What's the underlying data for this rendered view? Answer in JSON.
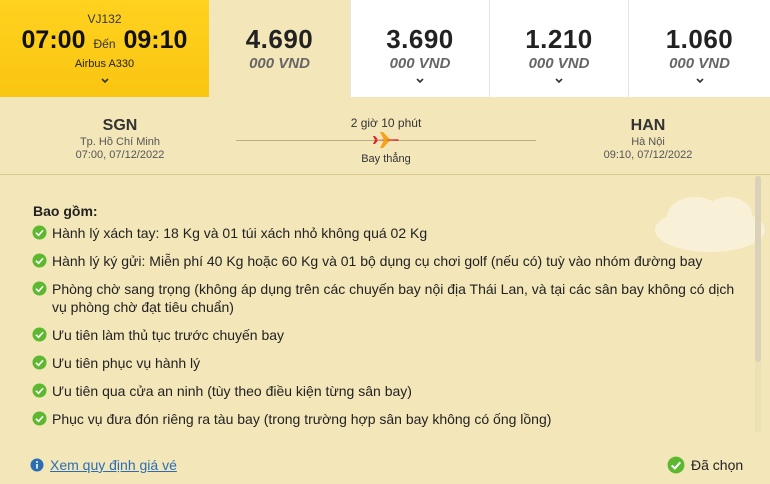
{
  "flight": {
    "code": "VJ132",
    "depart_time": "07:00",
    "connector": "Đến",
    "arrive_time": "09:10",
    "aircraft": "Airbus A330"
  },
  "fares": [
    {
      "amount": "4.690",
      "currency": "000 VND"
    },
    {
      "amount": "3.690",
      "currency": "000 VND"
    },
    {
      "amount": "1.210",
      "currency": "000 VND"
    },
    {
      "amount": "1.060",
      "currency": "000 VND"
    }
  ],
  "route": {
    "from": {
      "code": "SGN",
      "city": "Tp. Hồ Chí Minh",
      "datetime": "07:00, 07/12/2022"
    },
    "to": {
      "code": "HAN",
      "city": "Hà Nội",
      "datetime": "09:10, 07/12/2022"
    },
    "duration": "2 giờ 10 phút",
    "type": "Bay thẳng"
  },
  "details": {
    "title": "Bao gồm:",
    "benefits": [
      "Hành lý xách tay: 18 Kg và 01 túi xách nhỏ không quá 02 Kg",
      "Hành lý ký gửi: Miễn phí 40 Kg hoặc 60 Kg và 01 bộ dụng cụ chơi golf (nếu có) tuỳ vào nhóm đường bay",
      "Phòng chờ sang trọng (không áp dụng trên các chuyến bay nội địa Thái Lan, và tại các sân bay không có dịch vụ phòng chờ đạt tiêu chuẩn)",
      "Ưu tiên làm thủ tục trước chuyến bay",
      "Ưu tiên phục vụ hành lý",
      "Ưu tiên qua cửa an ninh (tùy theo điều kiện từng sân bay)",
      "Phục vụ đưa đón riêng ra tàu bay (trong trường hợp sân bay không có ống lồng)"
    ]
  },
  "footer": {
    "rules_link": "Xem quy định giá vé",
    "selected_label": "Đã chọn"
  },
  "icons": {
    "check": "check-circle-icon",
    "info": "info-icon",
    "plane": "plane-icon",
    "chevron": "chevron-down-icon"
  },
  "colors": {
    "brand_yellow": "#f9c511",
    "check_green": "#5cb82e",
    "plane_red": "#e0222a",
    "link_blue": "#2a6db5",
    "panel_bg": "#f3e6b9"
  }
}
